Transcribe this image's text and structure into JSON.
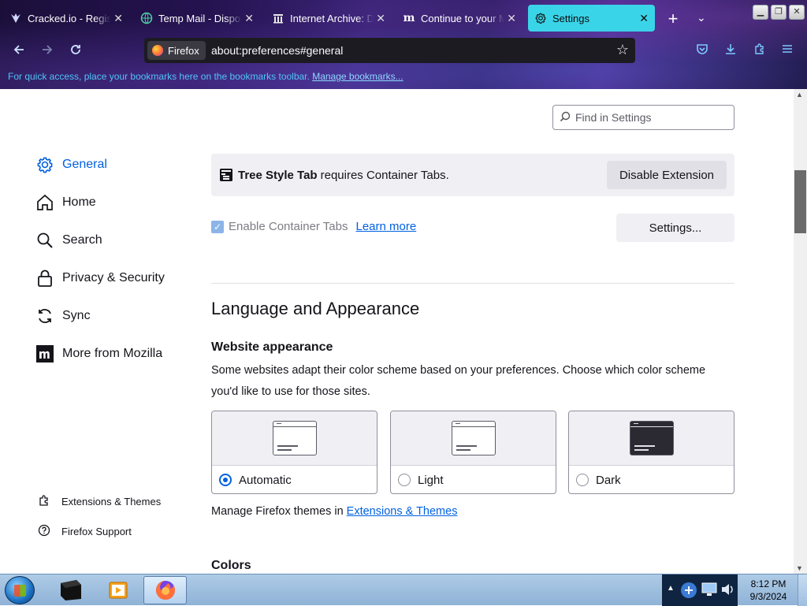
{
  "tabs": [
    {
      "label": "Cracked.io - Registra",
      "icon": "cracked-icon"
    },
    {
      "label": "Temp Mail - Disposa",
      "icon": "globe-icon"
    },
    {
      "label": "Internet Archive: Dig",
      "icon": "archive-icon"
    },
    {
      "label": "Continue to your Mo",
      "icon": "mozilla-m-icon"
    },
    {
      "label": "Settings",
      "icon": "gear-icon"
    }
  ],
  "navbar": {
    "identity_label": "Firefox",
    "url": "about:preferences#general"
  },
  "bookmarks_bar": {
    "message": "For quick access, place your bookmarks here on the bookmarks toolbar.",
    "link": "Manage bookmarks..."
  },
  "find": {
    "placeholder": "Find in Settings"
  },
  "sidebar": {
    "categories": [
      {
        "label": "General",
        "icon": "gear-icon",
        "selected": true
      },
      {
        "label": "Home",
        "icon": "home-icon"
      },
      {
        "label": "Search",
        "icon": "search-icon"
      },
      {
        "label": "Privacy & Security",
        "icon": "lock-icon"
      },
      {
        "label": "Sync",
        "icon": "sync-icon"
      },
      {
        "label": "More from Mozilla",
        "icon": "mozilla-icon"
      }
    ],
    "footer": [
      {
        "label": "Extensions & Themes",
        "icon": "puzzle-icon"
      },
      {
        "label": "Firefox Support",
        "icon": "help-icon"
      }
    ]
  },
  "notice": {
    "extension_name": "Tree Style Tab",
    "message": "requires Container Tabs.",
    "button": "Disable Extension"
  },
  "containers": {
    "checkbox_label": "Enable Container Tabs",
    "checked": true,
    "learn_more": "Learn more",
    "settings_button": "Settings..."
  },
  "language_appearance": {
    "heading": "Language and Appearance",
    "website_appearance": {
      "heading": "Website appearance",
      "description": "Some websites adapt their color scheme based on your preferences. Choose which color scheme you'd like to use for those sites.",
      "options": [
        {
          "label": "Automatic",
          "selected": true
        },
        {
          "label": "Light",
          "selected": false
        },
        {
          "label": "Dark",
          "selected": false
        }
      ]
    },
    "manage_themes_text": "Manage Firefox themes in",
    "manage_themes_link": "Extensions & Themes",
    "colors_heading": "Colors"
  },
  "taskbar": {
    "time": "8:12 PM",
    "date": "9/3/2024"
  },
  "colors": {
    "accent": "#0061e0",
    "active_tab": "#3ad4e8",
    "link": "#0061e0"
  }
}
